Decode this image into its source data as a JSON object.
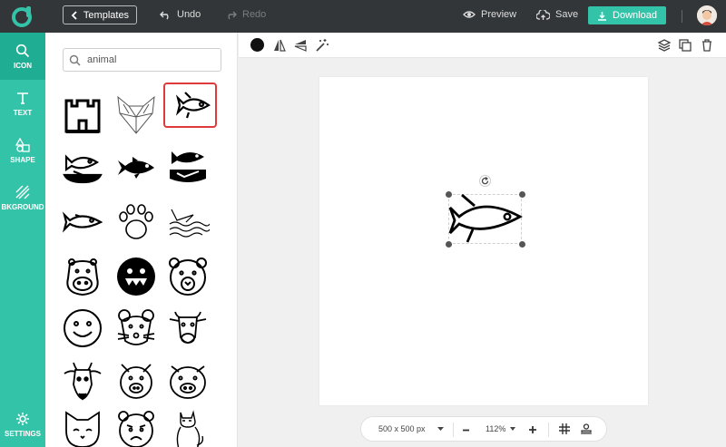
{
  "topbar": {
    "templates_label": "Templates",
    "undo_label": "Undo",
    "redo_label": "Redo",
    "preview_label": "Preview",
    "save_label": "Save",
    "download_label": "Download"
  },
  "rail": {
    "items": [
      {
        "label": "ICON",
        "icon": "search-icon",
        "active": true
      },
      {
        "label": "TEXT",
        "icon": "text-icon"
      },
      {
        "label": "SHAPE",
        "icon": "shape-icon"
      },
      {
        "label": "BKGROUND",
        "icon": "background-icon"
      }
    ],
    "settings_label": "SETTINGS"
  },
  "search": {
    "value": "animal",
    "placeholder": ""
  },
  "icons": [
    "castle-icon",
    "fox-head-icon",
    "fish-icon",
    "fish-on-plate-icon",
    "fish-solid-icon",
    "fish-platter-icon",
    "fish-simple-icon",
    "paw-print-icon",
    "fish-in-water-icon",
    "hippo-icon",
    "monster-face-icon",
    "bear-face-icon",
    "smiley-face-icon",
    "mouse-face-icon",
    "cow-face-icon",
    "goat-face-icon",
    "pig-face-icon",
    "pig-face-round-icon",
    "cat-face-icon",
    "grumpy-face-icon",
    "cat-sitting-icon"
  ],
  "selected_icon": "fish-icon",
  "canvas_toolbar": {
    "fill_color": "#111111"
  },
  "bottombar": {
    "size_label": "500 x 500 px",
    "zoom_label": "112%"
  },
  "colors": {
    "accent": "#33c3a8",
    "topbar": "#333639",
    "selection": "#e03b3b"
  }
}
